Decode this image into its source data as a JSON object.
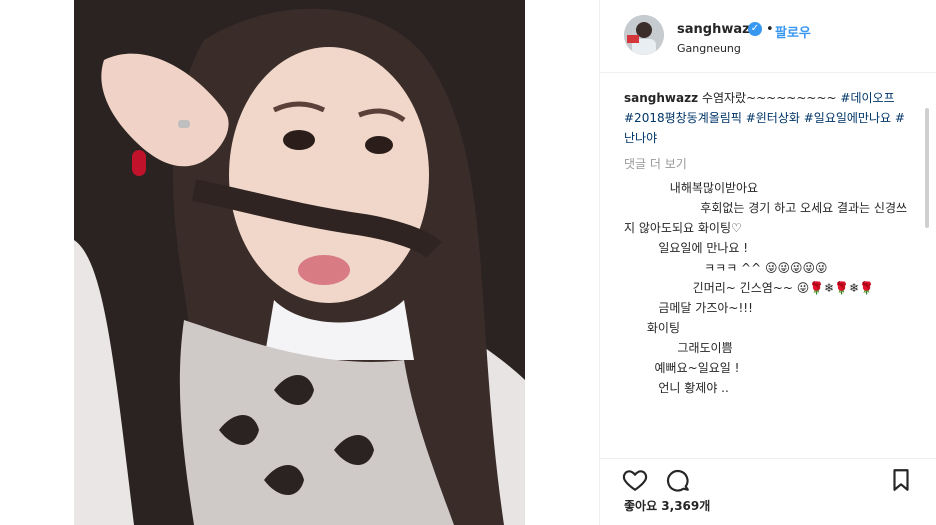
{
  "post": {
    "username": "sanghwazz",
    "follow_label": "팔로우",
    "location": "Gangneung",
    "caption_text": "수염자랐~~~~~~~~~",
    "hashtags": "#데이오프 #2018평창동계올림픽 #윈터상화 #일요일에만나요 #난나야",
    "more_comments_label": "댓글 더 보기",
    "likes_text": "좋아요 3,369개"
  },
  "comments": [
    "            내해복많이받아요",
    "                    후회없는 경기 하고 오세요 결과는 신경쓰지 않아도되요 화이팅♡",
    "         일요일에 만나요 !",
    "                     ㅋㅋㅋ ^^ 😜😜😜😜😜",
    "                  긴머리~ 긴스염~~ 😜🌹❄🌹❄🌹",
    "         금메달 가즈아~!!!",
    "      화이팅",
    "              그래도이쁨",
    "        예뻐요~일요일 !",
    "         언니 황제야 .."
  ],
  "icons": {
    "like": "heart-icon",
    "comment": "comment-icon",
    "save": "bookmark-icon",
    "verified": "verified-badge-icon"
  },
  "colors": {
    "link": "#3897f0",
    "hashtag": "#003569"
  }
}
